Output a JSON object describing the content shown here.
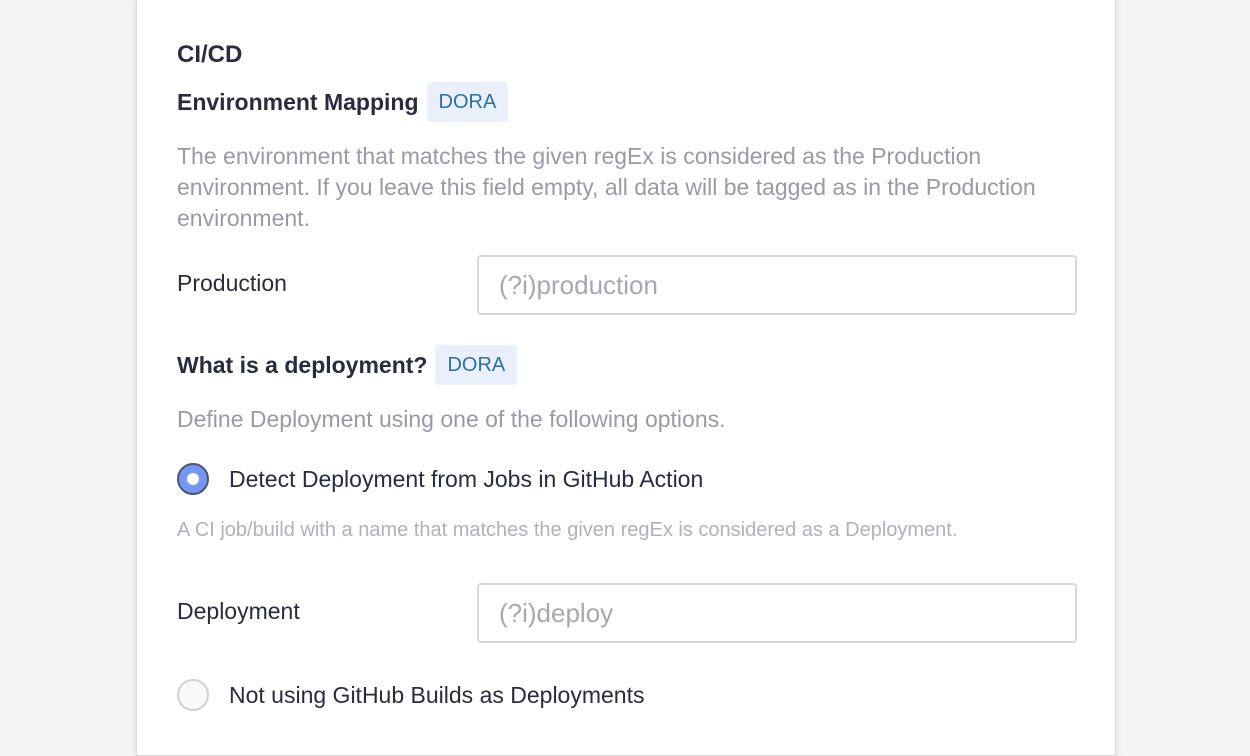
{
  "section": {
    "title": "CI/CD"
  },
  "environment_mapping": {
    "title": "Environment Mapping",
    "tag": "DORA",
    "description": "The environment that matches the given regEx is considered as the Production environment. If you leave this field empty, all data will be tagged as in the Production environment.",
    "production_label": "Production",
    "production_value": "",
    "production_placeholder": "(?i)production"
  },
  "deployment": {
    "title": "What is a deployment?",
    "tag": "DORA",
    "description": "Define Deployment using one of the following options.",
    "options": [
      {
        "label": "Detect Deployment from Jobs in GitHub Action",
        "selected": true
      },
      {
        "label": "Not using GitHub Builds as Deployments",
        "selected": false
      }
    ],
    "job_description": "A CI job/build with a name that matches the given regEx is considered as a Deployment.",
    "deployment_label": "Deployment",
    "deployment_value": "",
    "deployment_placeholder": "(?i)deploy"
  },
  "colors": {
    "tag_background": "#e9f0fb",
    "tag_text": "#2f6ea7",
    "radio_selected": "#7497f7",
    "muted_text": "#989aa5"
  }
}
